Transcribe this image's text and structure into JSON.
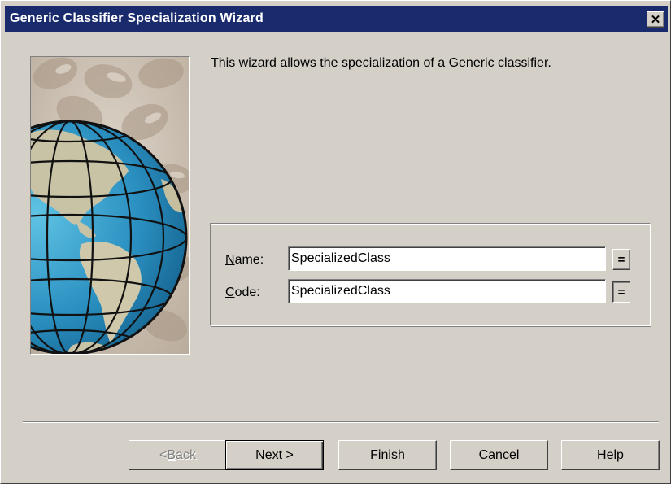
{
  "window": {
    "title": "Generic Classifier Specialization Wizard",
    "close_glyph": "✕"
  },
  "banner": {
    "icon": "globe-illustration"
  },
  "intro": {
    "text": "This wizard allows the specialization of a Generic classifier."
  },
  "fields": {
    "name": {
      "label_mnemonic": "N",
      "label_rest": "ame:",
      "value": "SpecializedClass",
      "sync_glyph": "="
    },
    "code": {
      "label_mnemonic": "C",
      "label_rest": "ode:",
      "value": "SpecializedClass",
      "sync_glyph": "="
    }
  },
  "buttons": {
    "back": {
      "prefix": "< ",
      "mnemonic": "B",
      "rest": "ack",
      "enabled": false
    },
    "next": {
      "mnemonic": "N",
      "rest": "ext >",
      "default": true
    },
    "finish": {
      "label": "Finish"
    },
    "cancel": {
      "label": "Cancel"
    },
    "help": {
      "label": "Help"
    }
  },
  "colors": {
    "titlebar": "#1a2b6d",
    "dialog_face": "#d4d0c8"
  }
}
